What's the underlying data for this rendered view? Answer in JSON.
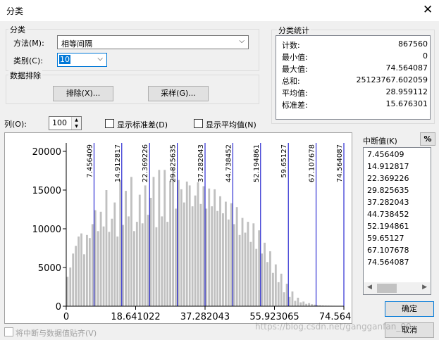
{
  "window": {
    "title": "分类",
    "close_glyph": "✕"
  },
  "classification": {
    "group_label": "分类",
    "method_label": "方法(M):",
    "method_value": "相等间隔",
    "classes_label": "类别(C):",
    "classes_value": "10"
  },
  "exclusion": {
    "group_label": "数据排除",
    "exclude_button": "排除(X)...",
    "sampling_button": "采样(G)..."
  },
  "stats": {
    "group_label": "分类统计",
    "rows": [
      {
        "key": "计数:",
        "value": "867560"
      },
      {
        "key": "最小值:",
        "value": "0"
      },
      {
        "key": "最大值:",
        "value": "74.564087"
      },
      {
        "key": "总和:",
        "value": "25123767.602059"
      },
      {
        "key": "平均值:",
        "value": "28.959112"
      },
      {
        "key": "标准差:",
        "value": "15.676301"
      }
    ]
  },
  "columns": {
    "label": "列(O):",
    "value": "100"
  },
  "options": {
    "show_std_label": "显示标准差(D)",
    "show_mean_label": "显示平均值(N)",
    "snap_label": "将中断与数据值贴齐(V)"
  },
  "breaks": {
    "label": "中断值(K)",
    "percent_button": "%",
    "values": [
      "7.456409",
      "14.912817",
      "22.369226",
      "29.825635",
      "37.282043",
      "44.738452",
      "52.194861",
      "59.65127",
      "67.107678",
      "74.564087"
    ]
  },
  "buttons": {
    "ok": "确定",
    "cancel": "取消"
  },
  "watermark": "https://blog.csdn.net/gangganfan_00",
  "colors": {
    "bar": "#c0c0c0",
    "break_line": "#0000c8",
    "selection": "#0078d7"
  },
  "chart_data": {
    "type": "bar",
    "x_range": [
      0,
      74.564087
    ],
    "ylim": [
      0,
      20000
    ],
    "y_ticks": [
      "0",
      "5000",
      "10000",
      "15000",
      "20000"
    ],
    "x_ticks": [
      {
        "value": 0,
        "label": "0"
      },
      {
        "value": 18.641022,
        "label": "18.641022"
      },
      {
        "value": 37.282043,
        "label": "37.282043"
      },
      {
        "value": 55.923065,
        "label": "55.923065"
      },
      {
        "value": 74.564087,
        "label": "74.564087"
      }
    ],
    "breaks": [
      7.456409,
      14.912817,
      22.369226,
      29.825635,
      37.282043,
      44.738452,
      52.194861,
      59.65127,
      67.107678,
      74.564087
    ],
    "break_labels": [
      "7.456409",
      "14.912817",
      "22.369226",
      "29.825635",
      "37.282043",
      "44.738452",
      "52.194861",
      "59.65127",
      "67.107678",
      "74.564087"
    ],
    "values": [
      3800,
      5000,
      6800,
      7800,
      9000,
      9400,
      6700,
      9200,
      8800,
      10600,
      12400,
      9700,
      12200,
      10300,
      15000,
      9600,
      11300,
      13400,
      9000,
      16300,
      10500,
      14900,
      11600,
      16700,
      9700,
      10900,
      14400,
      10700,
      15600,
      11800,
      14000,
      16700,
      10200,
      17600,
      11600,
      17600,
      10900,
      16200,
      17900,
      12600,
      16300,
      15100,
      13400,
      16100,
      15600,
      12900,
      14300,
      16000,
      13200,
      15500,
      12600,
      15200,
      12900,
      15100,
      12300,
      14200,
      12000,
      13500,
      11200,
      13300,
      10600,
      12800,
      9200,
      11400,
      9500,
      10900,
      8300,
      10700,
      7400,
      9800,
      6800,
      8200,
      5700,
      7100,
      4300,
      5400,
      3100,
      4200,
      1800,
      2900,
      1200,
      1900,
      700,
      1100,
      500,
      600,
      300,
      400,
      250,
      200,
      150,
      120,
      100,
      80,
      70,
      60,
      50,
      40,
      30,
      20
    ]
  }
}
